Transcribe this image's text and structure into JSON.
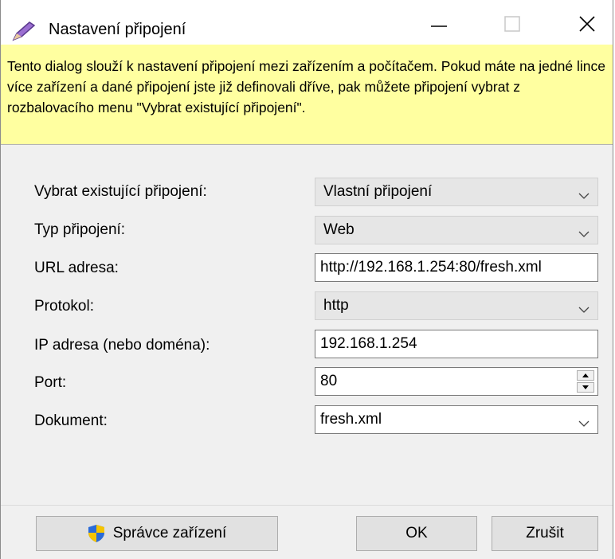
{
  "window": {
    "title": "Nastavení připojení"
  },
  "titlebar": {
    "minimize_icon": "minimize-icon",
    "maximize_icon": "maximize-icon",
    "close_icon": "close-icon"
  },
  "info": {
    "text": "Tento dialog slouží k nastavení připojení mezi zařízením a počítačem. Pokud máte na jedné lince více zařízení a dané připojení jste již definovali dříve, pak můžete připojení vybrat z rozbalovacího menu \"Vybrat existující připojení\"."
  },
  "form": {
    "existing": {
      "label": "Vybrat existující připojení:",
      "value": "Vlastní připojení"
    },
    "type": {
      "label": "Typ připojení:",
      "value": "Web"
    },
    "url": {
      "label": "URL adresa:",
      "value": "http://192.168.1.254:80/fresh.xml"
    },
    "protocol": {
      "label": "Protokol:",
      "value": "http"
    },
    "ip": {
      "label": "IP adresa (nebo doména):",
      "value": "192.168.1.254"
    },
    "port": {
      "label": "Port:",
      "value": "80"
    },
    "document": {
      "label": "Dokument:",
      "value": "fresh.xml"
    }
  },
  "buttons": {
    "device_manager": "Správce zařízení",
    "ok": "OK",
    "cancel": "Zrušit"
  },
  "colors": {
    "info_bg": "#ffffa0",
    "window_bg": "#f0f0f0"
  }
}
